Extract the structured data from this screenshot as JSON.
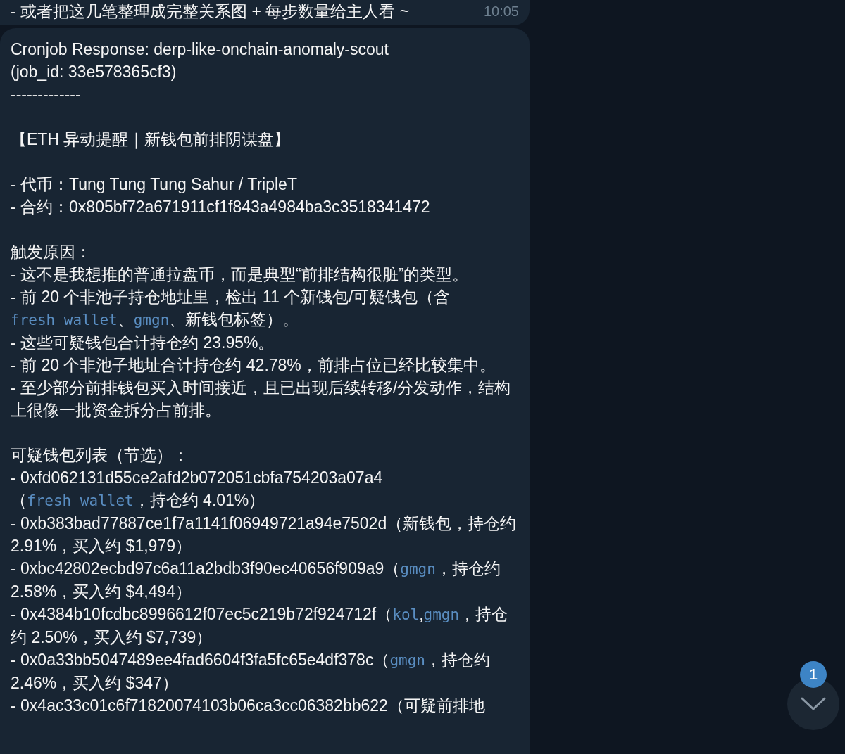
{
  "messages": [
    {
      "kind": "cut",
      "blocks": [
        [
          [
            {
              "kind": "plain",
              "text": "- 或者把这几笔整理成完整关系图 + 每步数量给主人看 ~"
            }
          ]
        ]
      ],
      "time": "10:05"
    },
    {
      "kind": "full",
      "blocks": [
        [
          [
            {
              "kind": "plain",
              "text": "Cronjob Response: derp-like-onchain-anomaly-scout"
            }
          ],
          [
            {
              "kind": "plain",
              "text": "(job_id: 33e578365cf3)"
            }
          ],
          [
            {
              "kind": "plain",
              "text": "-------------"
            }
          ]
        ],
        [
          [
            {
              "kind": "plain",
              "text": "【ETH 异动提醒｜新钱包前排阴谋盘】"
            }
          ]
        ],
        [
          [
            {
              "kind": "plain",
              "text": "- 代币：Tung Tung Tung Sahur / TripleT"
            }
          ],
          [
            {
              "kind": "plain",
              "text": "- 合约：0x805bf72a671911cf1f843a4984ba3c3518341472"
            }
          ]
        ],
        [
          [
            {
              "kind": "plain",
              "text": "触发原因："
            }
          ],
          [
            {
              "kind": "plain",
              "text": "- 这不是我想推的普通拉盘币，而是典型“前排结构很脏”的类型。"
            }
          ],
          [
            {
              "kind": "plain",
              "text": "- 前 20 个非池子持仓地址里，检出 11 个新钱包/可疑钱包（含 "
            },
            {
              "kind": "code",
              "text": "fresh_wallet"
            },
            {
              "kind": "plain",
              "text": "、"
            },
            {
              "kind": "code",
              "text": "gmgn"
            },
            {
              "kind": "plain",
              "text": "、新钱包标签）。"
            }
          ],
          [
            {
              "kind": "plain",
              "text": "- 这些可疑钱包合计持仓约 23.95%。"
            }
          ],
          [
            {
              "kind": "plain",
              "text": "- 前 20 个非池子地址合计持仓约 42.78%，前排占位已经比较集中。"
            }
          ],
          [
            {
              "kind": "plain",
              "text": "- 至少部分前排钱包买入时间接近，且已出现后续转移/分发动作，结构上很像一批资金拆分占前排。"
            }
          ]
        ],
        [
          [
            {
              "kind": "plain",
              "text": "可疑钱包列表（节选）："
            }
          ],
          [
            {
              "kind": "plain",
              "text": "- 0xfd062131d55ce2afd2b072051cbfa754203a07a4（"
            },
            {
              "kind": "code",
              "text": "fresh_wallet"
            },
            {
              "kind": "plain",
              "text": "，持仓约 4.01%）"
            }
          ],
          [
            {
              "kind": "plain",
              "text": "- 0xb383bad77887ce1f7a1141f06949721a94e7502d（新钱包，持仓约 2.91%，买入约 $1,979）"
            }
          ],
          [
            {
              "kind": "plain",
              "text": "- 0xbc42802ecbd97c6a11a2bdb3f90ec40656f909a9（"
            },
            {
              "kind": "code",
              "text": "gmgn"
            },
            {
              "kind": "plain",
              "text": "，持仓约 2.58%，买入约 $4,494）"
            }
          ],
          [
            {
              "kind": "plain",
              "text": "- 0x4384b10fcdbc8996612f07ec5c219b72f924712f（"
            },
            {
              "kind": "code",
              "text": "kol"
            },
            {
              "kind": "plain",
              "text": ","
            },
            {
              "kind": "code",
              "text": "gmgn"
            },
            {
              "kind": "plain",
              "text": "，持仓约 2.50%，买入约 $7,739）"
            }
          ],
          [
            {
              "kind": "plain",
              "text": "- 0x0a33bb5047489ee4fad6604f3fa5fc65e4df378c（"
            },
            {
              "kind": "code",
              "text": "gmgn"
            },
            {
              "kind": "plain",
              "text": "，持仓约 2.46%，买入约 $347）"
            }
          ],
          [
            {
              "kind": "plain",
              "text": "- 0x4ac33c01c6f71820074103b06ca3cc06382bb622（可疑前排地"
            }
          ]
        ]
      ]
    }
  ],
  "scroll_button": {
    "unread_badge": "1"
  }
}
